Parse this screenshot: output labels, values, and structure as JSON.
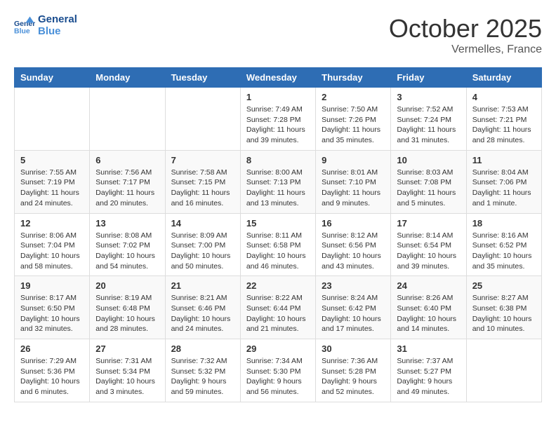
{
  "header": {
    "logo_text_general": "General",
    "logo_text_blue": "Blue",
    "month_title": "October 2025",
    "location": "Vermelles, France"
  },
  "days_of_week": [
    "Sunday",
    "Monday",
    "Tuesday",
    "Wednesday",
    "Thursday",
    "Friday",
    "Saturday"
  ],
  "weeks": [
    [
      {
        "day": "",
        "info": ""
      },
      {
        "day": "",
        "info": ""
      },
      {
        "day": "",
        "info": ""
      },
      {
        "day": "1",
        "info": "Sunrise: 7:49 AM\nSunset: 7:28 PM\nDaylight: 11 hours\nand 39 minutes."
      },
      {
        "day": "2",
        "info": "Sunrise: 7:50 AM\nSunset: 7:26 PM\nDaylight: 11 hours\nand 35 minutes."
      },
      {
        "day": "3",
        "info": "Sunrise: 7:52 AM\nSunset: 7:24 PM\nDaylight: 11 hours\nand 31 minutes."
      },
      {
        "day": "4",
        "info": "Sunrise: 7:53 AM\nSunset: 7:21 PM\nDaylight: 11 hours\nand 28 minutes."
      }
    ],
    [
      {
        "day": "5",
        "info": "Sunrise: 7:55 AM\nSunset: 7:19 PM\nDaylight: 11 hours\nand 24 minutes."
      },
      {
        "day": "6",
        "info": "Sunrise: 7:56 AM\nSunset: 7:17 PM\nDaylight: 11 hours\nand 20 minutes."
      },
      {
        "day": "7",
        "info": "Sunrise: 7:58 AM\nSunset: 7:15 PM\nDaylight: 11 hours\nand 16 minutes."
      },
      {
        "day": "8",
        "info": "Sunrise: 8:00 AM\nSunset: 7:13 PM\nDaylight: 11 hours\nand 13 minutes."
      },
      {
        "day": "9",
        "info": "Sunrise: 8:01 AM\nSunset: 7:10 PM\nDaylight: 11 hours\nand 9 minutes."
      },
      {
        "day": "10",
        "info": "Sunrise: 8:03 AM\nSunset: 7:08 PM\nDaylight: 11 hours\nand 5 minutes."
      },
      {
        "day": "11",
        "info": "Sunrise: 8:04 AM\nSunset: 7:06 PM\nDaylight: 11 hours\nand 1 minute."
      }
    ],
    [
      {
        "day": "12",
        "info": "Sunrise: 8:06 AM\nSunset: 7:04 PM\nDaylight: 10 hours\nand 58 minutes."
      },
      {
        "day": "13",
        "info": "Sunrise: 8:08 AM\nSunset: 7:02 PM\nDaylight: 10 hours\nand 54 minutes."
      },
      {
        "day": "14",
        "info": "Sunrise: 8:09 AM\nSunset: 7:00 PM\nDaylight: 10 hours\nand 50 minutes."
      },
      {
        "day": "15",
        "info": "Sunrise: 8:11 AM\nSunset: 6:58 PM\nDaylight: 10 hours\nand 46 minutes."
      },
      {
        "day": "16",
        "info": "Sunrise: 8:12 AM\nSunset: 6:56 PM\nDaylight: 10 hours\nand 43 minutes."
      },
      {
        "day": "17",
        "info": "Sunrise: 8:14 AM\nSunset: 6:54 PM\nDaylight: 10 hours\nand 39 minutes."
      },
      {
        "day": "18",
        "info": "Sunrise: 8:16 AM\nSunset: 6:52 PM\nDaylight: 10 hours\nand 35 minutes."
      }
    ],
    [
      {
        "day": "19",
        "info": "Sunrise: 8:17 AM\nSunset: 6:50 PM\nDaylight: 10 hours\nand 32 minutes."
      },
      {
        "day": "20",
        "info": "Sunrise: 8:19 AM\nSunset: 6:48 PM\nDaylight: 10 hours\nand 28 minutes."
      },
      {
        "day": "21",
        "info": "Sunrise: 8:21 AM\nSunset: 6:46 PM\nDaylight: 10 hours\nand 24 minutes."
      },
      {
        "day": "22",
        "info": "Sunrise: 8:22 AM\nSunset: 6:44 PM\nDaylight: 10 hours\nand 21 minutes."
      },
      {
        "day": "23",
        "info": "Sunrise: 8:24 AM\nSunset: 6:42 PM\nDaylight: 10 hours\nand 17 minutes."
      },
      {
        "day": "24",
        "info": "Sunrise: 8:26 AM\nSunset: 6:40 PM\nDaylight: 10 hours\nand 14 minutes."
      },
      {
        "day": "25",
        "info": "Sunrise: 8:27 AM\nSunset: 6:38 PM\nDaylight: 10 hours\nand 10 minutes."
      }
    ],
    [
      {
        "day": "26",
        "info": "Sunrise: 7:29 AM\nSunset: 5:36 PM\nDaylight: 10 hours\nand 6 minutes."
      },
      {
        "day": "27",
        "info": "Sunrise: 7:31 AM\nSunset: 5:34 PM\nDaylight: 10 hours\nand 3 minutes."
      },
      {
        "day": "28",
        "info": "Sunrise: 7:32 AM\nSunset: 5:32 PM\nDaylight: 9 hours\nand 59 minutes."
      },
      {
        "day": "29",
        "info": "Sunrise: 7:34 AM\nSunset: 5:30 PM\nDaylight: 9 hours\nand 56 minutes."
      },
      {
        "day": "30",
        "info": "Sunrise: 7:36 AM\nSunset: 5:28 PM\nDaylight: 9 hours\nand 52 minutes."
      },
      {
        "day": "31",
        "info": "Sunrise: 7:37 AM\nSunset: 5:27 PM\nDaylight: 9 hours\nand 49 minutes."
      },
      {
        "day": "",
        "info": ""
      }
    ]
  ]
}
